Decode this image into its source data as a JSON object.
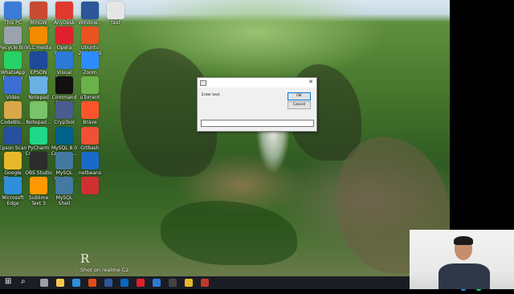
{
  "desktop": {
    "icons": [
      {
        "label": "This PC",
        "color": "#3a7bd5"
      },
      {
        "label": "MinGW Installer",
        "color": "#c84b31"
      },
      {
        "label": "AnyDesk",
        "color": "#e03a2f"
      },
      {
        "label": "Window...",
        "color": "#2b579a"
      },
      {
        "label": "test",
        "color": "#e6e6e6"
      },
      {
        "label": "Recycle Bin",
        "color": "#9aa3ad"
      },
      {
        "label": "VLC media player",
        "color": "#f28b00"
      },
      {
        "label": "Opera Browser",
        "color": "#e0202b"
      },
      {
        "label": "Ubuntu 20.04 LTS",
        "color": "#e95420"
      },
      {
        "label": "WhatsApp Desktop",
        "color": "#25d366"
      },
      {
        "label": "EPSON Manuals",
        "color": "#1e4a99"
      },
      {
        "label": "Visual Studi...",
        "color": "#2d7ad6"
      },
      {
        "label": "Zoom",
        "color": "#2d8cff"
      },
      {
        "label": "Video editor",
        "color": "#3b6fd4"
      },
      {
        "label": "Notepad",
        "color": "#6ab0e5"
      },
      {
        "label": "Command Prompt",
        "color": "#111111"
      },
      {
        "label": "uTorrent",
        "color": "#6bb14a"
      },
      {
        "label": "CodeBlo...",
        "color": "#d9a84a"
      },
      {
        "label": "Notepad...",
        "color": "#7ac36a"
      },
      {
        "label": "CrypTool",
        "color": "#4a5d8f"
      },
      {
        "label": "Brave",
        "color": "#fb542b"
      },
      {
        "label": "Epson Scan 2",
        "color": "#2850a0"
      },
      {
        "label": "PyCharm Commun...",
        "color": "#21d789"
      },
      {
        "label": "MySQL 8.0 Comman...",
        "color": "#00618a"
      },
      {
        "label": "GitBash",
        "color": "#f05033"
      },
      {
        "label": "Google Chrome",
        "color": "#e8b82a"
      },
      {
        "label": "OBS Studio",
        "color": "#2b2b2b"
      },
      {
        "label": "MySQL Workb...",
        "color": "#4479a1"
      },
      {
        "label": "netbeans",
        "color": "#1b6ac9"
      },
      {
        "label": "Microsoft Edge",
        "color": "#2f8fd8"
      },
      {
        "label": "Sublime Text 3",
        "color": "#ff9800"
      },
      {
        "label": "MySQL Shell",
        "color": "#4479a1"
      },
      {
        "label": "",
        "color": "#d03030"
      }
    ]
  },
  "dialog": {
    "prompt": "Enter text",
    "ok_label": "OK",
    "cancel_label": "Cancel",
    "input_value": "",
    "close_glyph": "✕"
  },
  "watermark": {
    "logo": "R",
    "text": "Shot on realme C2"
  },
  "taskbar": {
    "start_glyph": "⊞",
    "search_glyph": "⌕",
    "icons": [
      {
        "name": "task-view-icon",
        "color": "#9aa0a8"
      },
      {
        "name": "file-explorer-icon",
        "color": "#f2c94c"
      },
      {
        "name": "edge-icon",
        "color": "#2f8fd8"
      },
      {
        "name": "office-icon",
        "color": "#e64a19"
      },
      {
        "name": "word-icon",
        "color": "#2b579a"
      },
      {
        "name": "linkedin-icon",
        "color": "#0a66c2"
      },
      {
        "name": "opera-icon",
        "color": "#e0202b"
      },
      {
        "name": "vscode-icon",
        "color": "#2d7ad6"
      },
      {
        "name": "obs-icon",
        "color": "#444444"
      },
      {
        "name": "chrome-icon",
        "color": "#e8b82a"
      },
      {
        "name": "app-icon",
        "color": "#c0392b"
      }
    ]
  }
}
